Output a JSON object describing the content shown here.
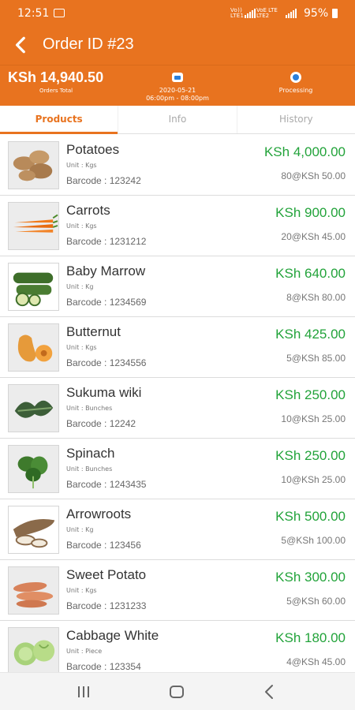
{
  "status_bar": {
    "time": "12:51",
    "network_1": "Vo)) LTE1",
    "network_2": "VoE LTE LTE2",
    "battery": "95%"
  },
  "app_bar": {
    "title": "Order ID #23"
  },
  "summary": {
    "total": "KSh 14,940.50",
    "total_label": "Orders Total",
    "date": "2020-05-21",
    "time_window": "06:00pm - 08:00pm",
    "status": "Processing"
  },
  "tabs": [
    "Products",
    "Info",
    "History"
  ],
  "active_tab": "Products",
  "products": [
    {
      "name": "Potatoes",
      "unit": "Unit : Kgs",
      "barcode": "Barcode : 123242",
      "price": "KSh 4,000.00",
      "qty": "80@KSh 50.00",
      "image": "potatoes"
    },
    {
      "name": "Carrots",
      "unit": "Unit : Kgs",
      "barcode": "Barcode : 1231212",
      "price": "KSh 900.00",
      "qty": "20@KSh 45.00",
      "image": "carrots"
    },
    {
      "name": "Baby Marrow",
      "unit": "Unit : Kg",
      "barcode": "Barcode : 1234569",
      "price": "KSh 640.00",
      "qty": "8@KSh 80.00",
      "image": "baby-marrow"
    },
    {
      "name": "Butternut",
      "unit": "Unit : Kgs",
      "barcode": "Barcode : 1234556",
      "price": "KSh 425.00",
      "qty": "5@KSh 85.00",
      "image": "butternut"
    },
    {
      "name": "Sukuma wiki",
      "unit": "Unit : Bunches",
      "barcode": "Barcode : 12242",
      "price": "KSh 250.00",
      "qty": "10@KSh 25.00",
      "image": "sukuma-wiki"
    },
    {
      "name": "Spinach",
      "unit": "Unit : Bunches",
      "barcode": "Barcode : 1243435",
      "price": "KSh 250.00",
      "qty": "10@KSh 25.00",
      "image": "spinach"
    },
    {
      "name": "Arrowroots",
      "unit": "Unit : Kg",
      "barcode": "Barcode : 123456",
      "price": "KSh 500.00",
      "qty": "5@KSh 100.00",
      "image": "arrowroots"
    },
    {
      "name": "Sweet Potato",
      "unit": "Unit : Kgs",
      "barcode": "Barcode : 1231233",
      "price": "KSh 300.00",
      "qty": "5@KSh 60.00",
      "image": "sweet-potato"
    },
    {
      "name": "Cabbage White",
      "unit": "Unit : Piece",
      "barcode": "Barcode : 123354",
      "price": "KSh 180.00",
      "qty": "4@KSh 45.00",
      "image": "cabbage"
    }
  ],
  "nav_bar": {
    "recents": "recents-icon",
    "home": "home-icon",
    "back": "back-icon"
  },
  "colors": {
    "brand": "#e8731f",
    "price": "#22a33a"
  }
}
